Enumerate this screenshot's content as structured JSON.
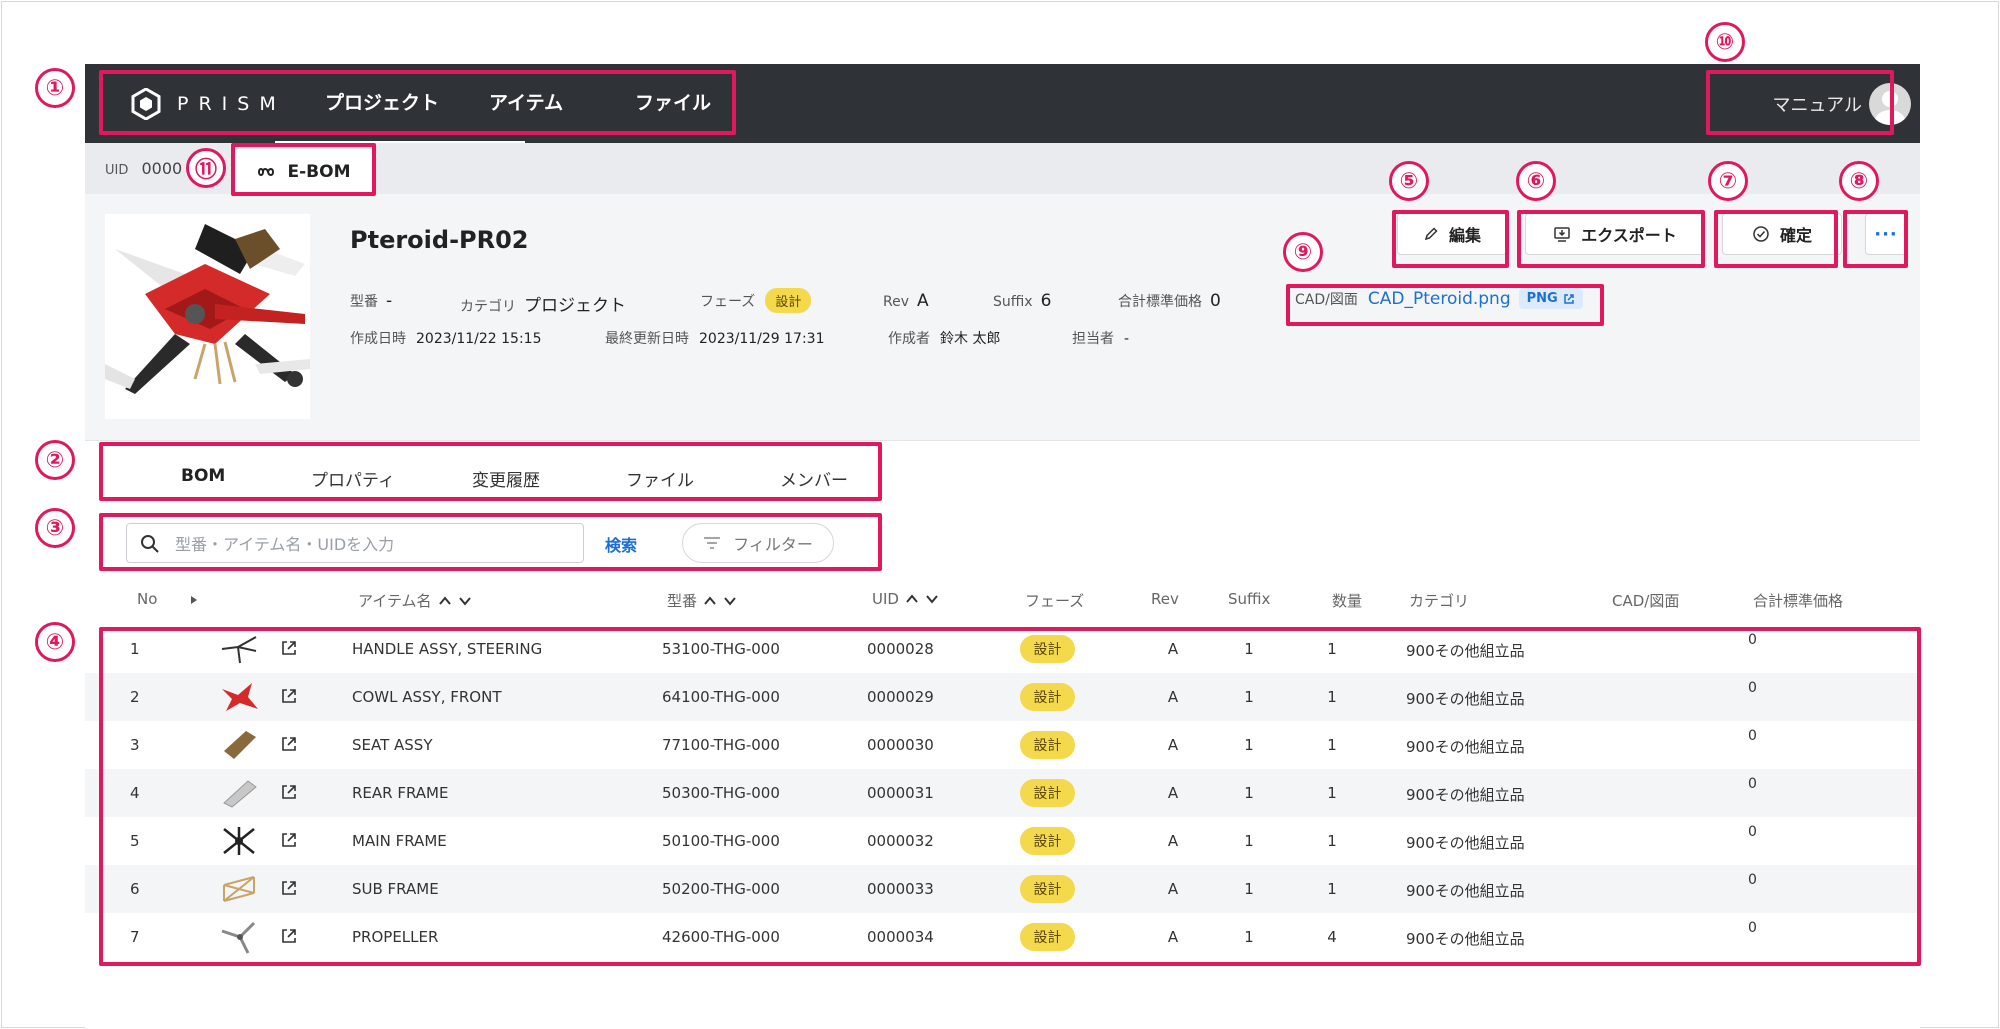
{
  "nav": {
    "brand": "PRISM",
    "items": [
      "プロジェクト",
      "アイテム",
      "ファイル"
    ],
    "manual": "マニュアル"
  },
  "subbar": {
    "uid_label": "UID",
    "uid_value": "0000",
    "tab": "E-BOM"
  },
  "project": {
    "name": "Pteroid-PR02",
    "model_label": "型番",
    "model": "-",
    "category_label": "カテゴリ",
    "category": "プロジェクト",
    "phase_label": "フェーズ",
    "phase": "設計",
    "rev_label": "Rev",
    "rev": "A",
    "suffix_label": "Suffix",
    "suffix": "6",
    "total_label": "合計標準価格",
    "total": "0",
    "created_label": "作成日時",
    "created": "2023/11/22 15:15",
    "updated_label": "最終更新日時",
    "updated": "2023/11/29 17:31",
    "author_label": "作成者",
    "author": "鈴木 太郎",
    "assignee_label": "担当者",
    "assignee": "-",
    "cad_label": "CAD/図面",
    "cad_file": "CAD_Pteroid.png",
    "cad_type": "PNG"
  },
  "actions": {
    "edit": "編集",
    "export": "エクスポート",
    "confirm": "確定",
    "more": "···"
  },
  "tabs": [
    "BOM",
    "プロパティ",
    "変更履歴",
    "ファイル",
    "メンバー"
  ],
  "search": {
    "placeholder": "型番・アイテム名・UIDを入力",
    "button": "検索",
    "filter": "フィルター"
  },
  "table": {
    "headers": {
      "no": "No",
      "name": "アイテム名",
      "model": "型番",
      "uid": "UID",
      "phase": "フェーズ",
      "rev": "Rev",
      "suffix": "Suffix",
      "qty": "数量",
      "category": "カテゴリ",
      "cad": "CAD/図面",
      "price": "合計標準価格"
    },
    "rows": [
      {
        "no": "1",
        "name": "HANDLE ASSY, STEERING",
        "model": "53100-THG-000",
        "uid": "0000028",
        "phase": "設計",
        "rev": "A",
        "suffix": "1",
        "qty": "1",
        "category": "900その他組立品",
        "price": "0"
      },
      {
        "no": "2",
        "name": "COWL ASSY, FRONT",
        "model": "64100-THG-000",
        "uid": "0000029",
        "phase": "設計",
        "rev": "A",
        "suffix": "1",
        "qty": "1",
        "category": "900その他組立品",
        "price": "0"
      },
      {
        "no": "3",
        "name": "SEAT ASSY",
        "model": "77100-THG-000",
        "uid": "0000030",
        "phase": "設計",
        "rev": "A",
        "suffix": "1",
        "qty": "1",
        "category": "900その他組立品",
        "price": "0"
      },
      {
        "no": "4",
        "name": "REAR FRAME",
        "model": "50300-THG-000",
        "uid": "0000031",
        "phase": "設計",
        "rev": "A",
        "suffix": "1",
        "qty": "1",
        "category": "900その他組立品",
        "price": "0"
      },
      {
        "no": "5",
        "name": "MAIN FRAME",
        "model": "50100-THG-000",
        "uid": "0000032",
        "phase": "設計",
        "rev": "A",
        "suffix": "1",
        "qty": "1",
        "category": "900その他組立品",
        "price": "0"
      },
      {
        "no": "6",
        "name": "SUB FRAME",
        "model": "50200-THG-000",
        "uid": "0000033",
        "phase": "設計",
        "rev": "A",
        "suffix": "1",
        "qty": "1",
        "category": "900その他組立品",
        "price": "0"
      },
      {
        "no": "7",
        "name": "PROPELLER",
        "model": "42600-THG-000",
        "uid": "0000034",
        "phase": "設計",
        "rev": "A",
        "suffix": "1",
        "qty": "4",
        "category": "900その他組立品",
        "price": "0"
      }
    ]
  },
  "annotations": [
    "①",
    "②",
    "③",
    "④",
    "⑤",
    "⑥",
    "⑦",
    "⑧",
    "⑨",
    "⑩",
    "⑪"
  ],
  "colors": {
    "highlight": "#e0185e",
    "nav_bg": "#2f3338",
    "link": "#1d6fd1",
    "phase_badge": "#f5d94d"
  }
}
